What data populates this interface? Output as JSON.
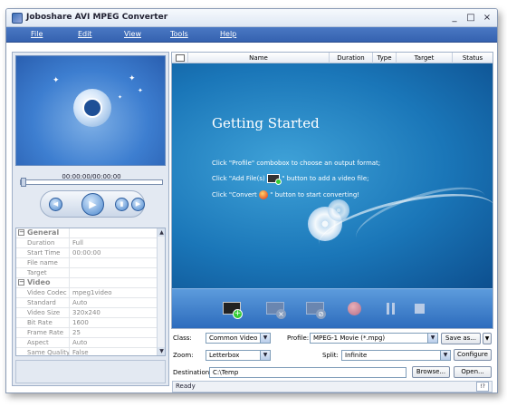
{
  "window": {
    "title": "Joboshare AVI MPEG Converter",
    "min": "_",
    "max": "□",
    "close": "×"
  },
  "menu": [
    "File",
    "Edit",
    "View",
    "Tools",
    "Help"
  ],
  "player": {
    "timecode": "00:00:00/00:00:00"
  },
  "properties": [
    {
      "type": "group",
      "label": "General",
      "toggle": "−"
    },
    {
      "type": "row",
      "key": "Duration",
      "value": "Full"
    },
    {
      "type": "row",
      "key": "Start Time",
      "value": "00:00:00"
    },
    {
      "type": "row",
      "key": "File name",
      "value": ""
    },
    {
      "type": "row",
      "key": "Target",
      "value": ""
    },
    {
      "type": "group",
      "label": "Video",
      "toggle": "−"
    },
    {
      "type": "row",
      "key": "Video Codec",
      "value": "mpeg1video"
    },
    {
      "type": "row",
      "key": "Standard",
      "value": "Auto"
    },
    {
      "type": "row",
      "key": "Video Size",
      "value": "320x240"
    },
    {
      "type": "row",
      "key": "Bit Rate",
      "value": "1600"
    },
    {
      "type": "row",
      "key": "Frame Rate",
      "value": "25"
    },
    {
      "type": "row",
      "key": "Aspect",
      "value": "Auto"
    },
    {
      "type": "row",
      "key": "Same Quality",
      "value": "False"
    }
  ],
  "filelist": {
    "columns": [
      "Name",
      "Duration",
      "Type",
      "Target",
      "Status"
    ]
  },
  "getting_started": {
    "title": "Getting Started",
    "line1": "Click \"Profile\" combobox to choose an output format;",
    "line2a": "Click \"Add File(s)",
    "line2b": "\" button to add a video file;",
    "line3a": "Click \"Convert",
    "line3b": "\" button to start converting!"
  },
  "controls": {
    "class_label": "Class:",
    "class_value": "Common Video",
    "profile_label": "Profile:",
    "profile_value": "MPEG-1 Movie  (*.mpg)",
    "save_as": "Save as...",
    "zoom_label": "Zoom:",
    "zoom_value": "Letterbox",
    "split_label": "Split:",
    "split_value": "Infinite",
    "configure": "Configure",
    "destination_label": "Destination:",
    "destination_value": "C:\\Temp",
    "browse": "Browse...",
    "open": "Open..."
  },
  "status": {
    "text": "Ready",
    "help": "!?"
  },
  "colors": {
    "menubar": "#3562b0",
    "stage": "#1a76b8",
    "accent": "#4a86cc"
  }
}
